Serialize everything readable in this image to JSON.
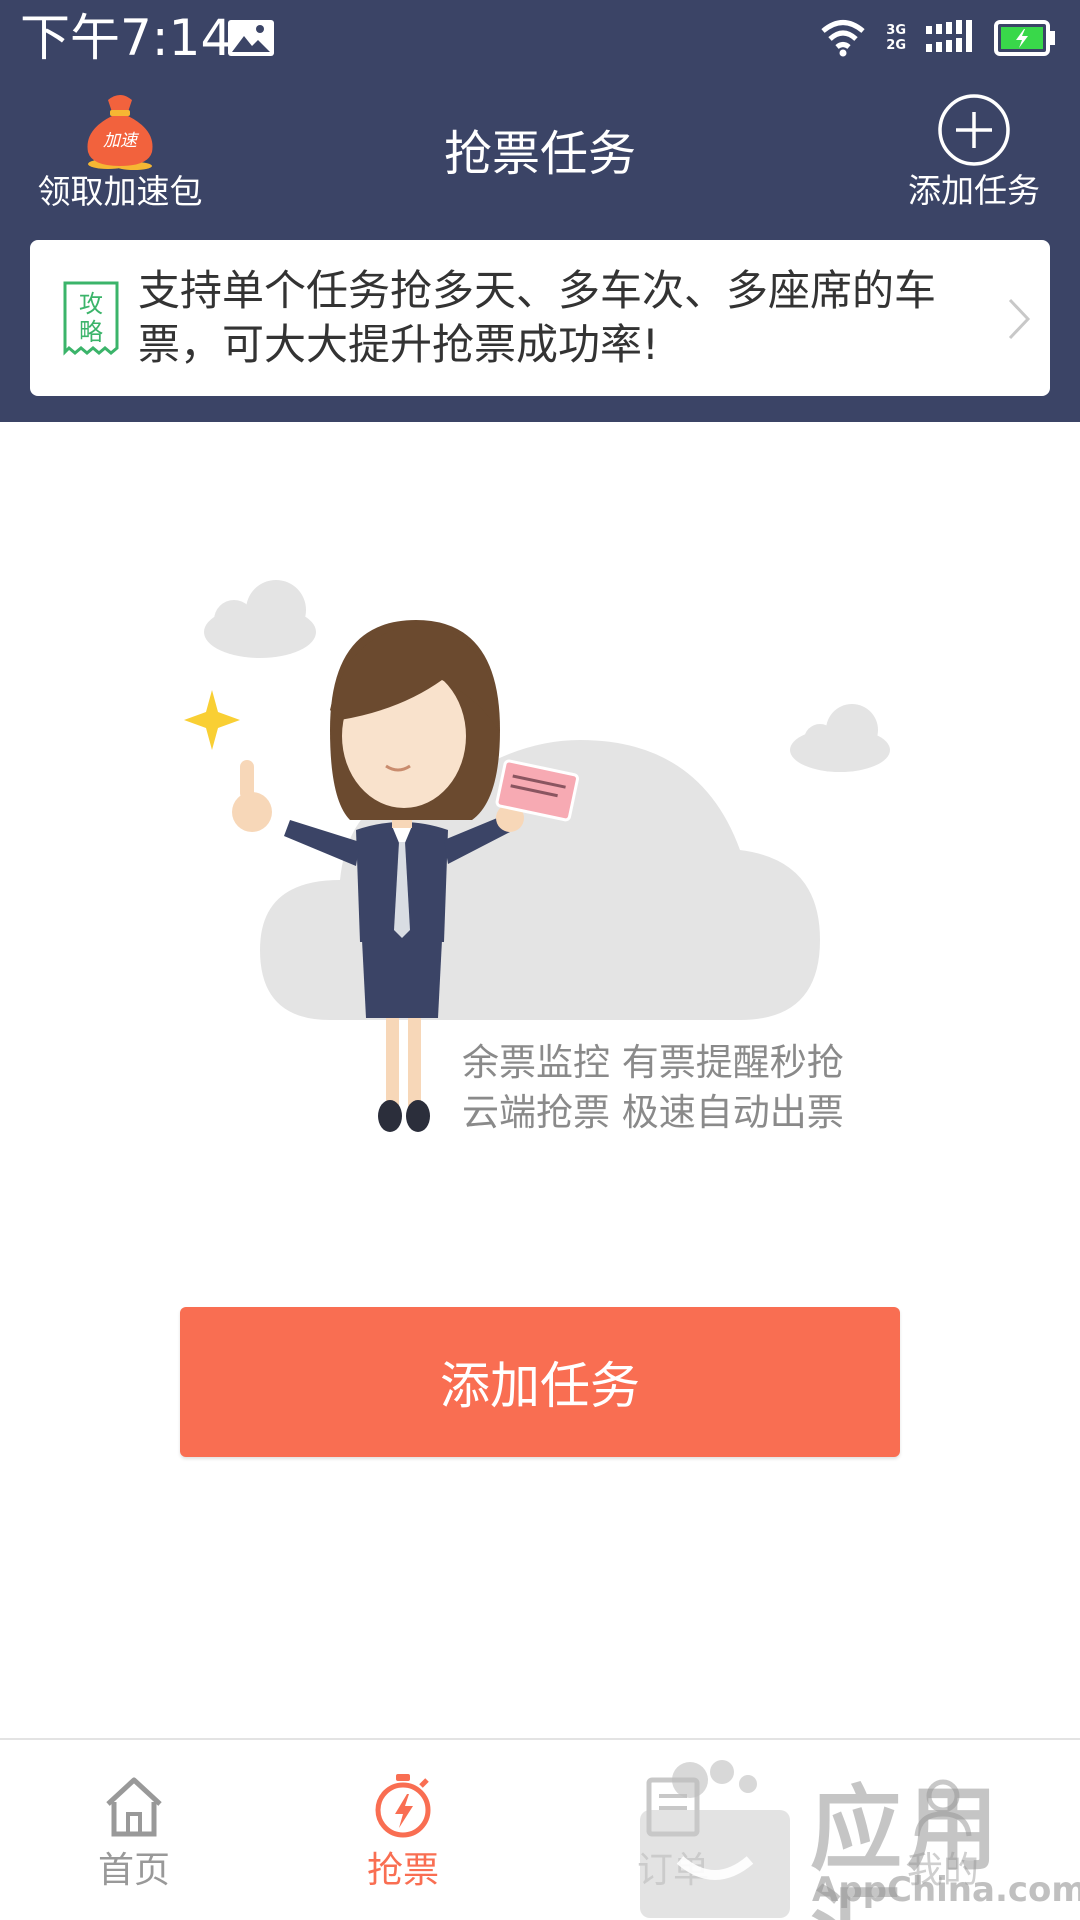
{
  "status_bar": {
    "time": "下午7:14",
    "net_top": "3G",
    "net_bottom": "2G"
  },
  "header": {
    "speed_pack_badge": "加速",
    "speed_pack_label": "领取加速包",
    "title": "抢票任务",
    "add_task_label": "添加任务"
  },
  "tip": {
    "badge_top": "攻",
    "badge_bottom": "略",
    "text": "支持单个任务抢多天、多车次、多座席的车票，可大大提升抢票成功率!"
  },
  "features": {
    "line1": "余票监控 有票提醒秒抢",
    "line2": "云端抢票 极速自动出票"
  },
  "main_button": {
    "label": "添加任务"
  },
  "bottom_nav": {
    "items": [
      {
        "label": "首页",
        "icon": "home-icon",
        "active": false
      },
      {
        "label": "抢票",
        "icon": "stopwatch-icon",
        "active": true
      },
      {
        "label": "订单",
        "icon": "order-icon",
        "active": false
      },
      {
        "label": "我的",
        "icon": "profile-icon",
        "active": false
      }
    ]
  },
  "watermark": {
    "text": "应用汇",
    "sub": "AppChina.com"
  },
  "colors": {
    "header_bg": "#3b4466",
    "accent": "#f96e52",
    "tip_green": "#3bb46a"
  }
}
